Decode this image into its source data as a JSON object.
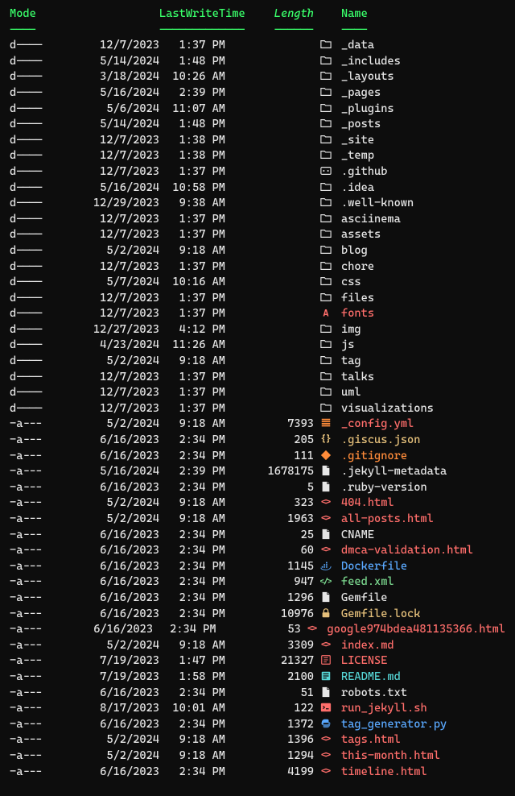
{
  "headers": {
    "mode": "Mode",
    "lastwrite": "LastWriteTime",
    "length": "Length",
    "name": "Name"
  },
  "separators": {
    "mode": "----",
    "lastwrite": "-------------",
    "length": "------",
    "name": "----"
  },
  "rows": [
    {
      "mode": "d----",
      "date": "12/7/2023",
      "time": "1:37 PM",
      "length": "",
      "icon": "folder",
      "name": "_data",
      "iconColor": "c-white",
      "nameColor": "c-white"
    },
    {
      "mode": "d----",
      "date": "5/14/2024",
      "time": "1:48 PM",
      "length": "",
      "icon": "folder",
      "name": "_includes",
      "iconColor": "c-white",
      "nameColor": "c-white"
    },
    {
      "mode": "d----",
      "date": "3/18/2024",
      "time": "10:26 AM",
      "length": "",
      "icon": "folder",
      "name": "_layouts",
      "iconColor": "c-white",
      "nameColor": "c-white"
    },
    {
      "mode": "d----",
      "date": "5/16/2024",
      "time": "2:39 PM",
      "length": "",
      "icon": "folder",
      "name": "_pages",
      "iconColor": "c-white",
      "nameColor": "c-white"
    },
    {
      "mode": "d----",
      "date": "5/6/2024",
      "time": "11:07 AM",
      "length": "",
      "icon": "folder",
      "name": "_plugins",
      "iconColor": "c-white",
      "nameColor": "c-white"
    },
    {
      "mode": "d----",
      "date": "5/14/2024",
      "time": "1:48 PM",
      "length": "",
      "icon": "folder",
      "name": "_posts",
      "iconColor": "c-white",
      "nameColor": "c-white"
    },
    {
      "mode": "d----",
      "date": "12/7/2023",
      "time": "1:38 PM",
      "length": "",
      "icon": "folder",
      "name": "_site",
      "iconColor": "c-white",
      "nameColor": "c-white"
    },
    {
      "mode": "d----",
      "date": "12/7/2023",
      "time": "1:38 PM",
      "length": "",
      "icon": "folder",
      "name": "_temp",
      "iconColor": "c-white",
      "nameColor": "c-white"
    },
    {
      "mode": "d----",
      "date": "12/7/2023",
      "time": "1:37 PM",
      "length": "",
      "icon": "github",
      "name": ".github",
      "iconColor": "c-white",
      "nameColor": "c-white"
    },
    {
      "mode": "d----",
      "date": "5/16/2024",
      "time": "10:58 PM",
      "length": "",
      "icon": "folder",
      "name": ".idea",
      "iconColor": "c-white",
      "nameColor": "c-white"
    },
    {
      "mode": "d----",
      "date": "12/29/2023",
      "time": "9:38 AM",
      "length": "",
      "icon": "folder",
      "name": ".well-known",
      "iconColor": "c-white",
      "nameColor": "c-white"
    },
    {
      "mode": "d----",
      "date": "12/7/2023",
      "time": "1:37 PM",
      "length": "",
      "icon": "folder",
      "name": "asciinema",
      "iconColor": "c-white",
      "nameColor": "c-white"
    },
    {
      "mode": "d----",
      "date": "12/7/2023",
      "time": "1:37 PM",
      "length": "",
      "icon": "folder",
      "name": "assets",
      "iconColor": "c-white",
      "nameColor": "c-white"
    },
    {
      "mode": "d----",
      "date": "5/2/2024",
      "time": "9:18 AM",
      "length": "",
      "icon": "folder",
      "name": "blog",
      "iconColor": "c-white",
      "nameColor": "c-white"
    },
    {
      "mode": "d----",
      "date": "12/7/2023",
      "time": "1:37 PM",
      "length": "",
      "icon": "folder",
      "name": "chore",
      "iconColor": "c-white",
      "nameColor": "c-white"
    },
    {
      "mode": "d----",
      "date": "5/7/2024",
      "time": "10:16 AM",
      "length": "",
      "icon": "folder",
      "name": "css",
      "iconColor": "c-white",
      "nameColor": "c-white"
    },
    {
      "mode": "d----",
      "date": "12/7/2023",
      "time": "1:37 PM",
      "length": "",
      "icon": "folder",
      "name": "files",
      "iconColor": "c-white",
      "nameColor": "c-white"
    },
    {
      "mode": "d----",
      "date": "12/7/2023",
      "time": "1:37 PM",
      "length": "",
      "icon": "fontA",
      "name": "fonts",
      "iconColor": "c-red",
      "nameColor": "c-red"
    },
    {
      "mode": "d----",
      "date": "12/27/2023",
      "time": "4:12 PM",
      "length": "",
      "icon": "folder",
      "name": "img",
      "iconColor": "c-white",
      "nameColor": "c-white"
    },
    {
      "mode": "d----",
      "date": "4/23/2024",
      "time": "11:26 AM",
      "length": "",
      "icon": "folder",
      "name": "js",
      "iconColor": "c-white",
      "nameColor": "c-white"
    },
    {
      "mode": "d----",
      "date": "5/2/2024",
      "time": "9:18 AM",
      "length": "",
      "icon": "folder",
      "name": "tag",
      "iconColor": "c-white",
      "nameColor": "c-white"
    },
    {
      "mode": "d----",
      "date": "12/7/2023",
      "time": "1:37 PM",
      "length": "",
      "icon": "folder",
      "name": "talks",
      "iconColor": "c-white",
      "nameColor": "c-white"
    },
    {
      "mode": "d----",
      "date": "12/7/2023",
      "time": "1:37 PM",
      "length": "",
      "icon": "folder",
      "name": "uml",
      "iconColor": "c-white",
      "nameColor": "c-white"
    },
    {
      "mode": "d----",
      "date": "12/7/2023",
      "time": "1:37 PM",
      "length": "",
      "icon": "folder",
      "name": "visualizations",
      "iconColor": "c-white",
      "nameColor": "c-white"
    },
    {
      "mode": "-a---",
      "date": "5/2/2024",
      "time": "9:18 AM",
      "length": "7393",
      "icon": "lines",
      "name": "_config.yml",
      "iconColor": "c-orange",
      "nameColor": "c-red"
    },
    {
      "mode": "-a---",
      "date": "6/16/2023",
      "time": "2:34 PM",
      "length": "205",
      "icon": "braces",
      "name": ".giscus.json",
      "iconColor": "c-yellow",
      "nameColor": "c-yellow"
    },
    {
      "mode": "-a---",
      "date": "6/16/2023",
      "time": "2:34 PM",
      "length": "111",
      "icon": "gitdiamond",
      "name": ".gitignore",
      "iconColor": "c-orange",
      "nameColor": "c-orange"
    },
    {
      "mode": "-a---",
      "date": "5/16/2024",
      "time": "2:39 PM",
      "length": "1678175",
      "icon": "file",
      "name": ".jekyll-metadata",
      "iconColor": "c-white",
      "nameColor": "c-white"
    },
    {
      "mode": "-a---",
      "date": "6/16/2023",
      "time": "2:34 PM",
      "length": "5",
      "icon": "file",
      "name": ".ruby-version",
      "iconColor": "c-white",
      "nameColor": "c-white"
    },
    {
      "mode": "-a---",
      "date": "5/2/2024",
      "time": "9:18 AM",
      "length": "323",
      "icon": "code",
      "name": "404.html",
      "iconColor": "c-red",
      "nameColor": "c-red"
    },
    {
      "mode": "-a---",
      "date": "5/2/2024",
      "time": "9:18 AM",
      "length": "1963",
      "icon": "code",
      "name": "all-posts.html",
      "iconColor": "c-red",
      "nameColor": "c-red"
    },
    {
      "mode": "-a---",
      "date": "6/16/2023",
      "time": "2:34 PM",
      "length": "25",
      "icon": "file",
      "name": "CNAME",
      "iconColor": "c-white",
      "nameColor": "c-white"
    },
    {
      "mode": "-a---",
      "date": "6/16/2023",
      "time": "2:34 PM",
      "length": "60",
      "icon": "code",
      "name": "dmca-validation.html",
      "iconColor": "c-red",
      "nameColor": "c-red"
    },
    {
      "mode": "-a---",
      "date": "6/16/2023",
      "time": "2:34 PM",
      "length": "1145",
      "icon": "docker",
      "name": "Dockerfile",
      "iconColor": "c-blue",
      "nameColor": "c-blue"
    },
    {
      "mode": "-a---",
      "date": "6/16/2023",
      "time": "2:34 PM",
      "length": "947",
      "icon": "codeslash",
      "name": "feed.xml",
      "iconColor": "c-green",
      "nameColor": "c-green"
    },
    {
      "mode": "-a---",
      "date": "6/16/2023",
      "time": "2:34 PM",
      "length": "1296",
      "icon": "file",
      "name": "Gemfile",
      "iconColor": "c-white",
      "nameColor": "c-white"
    },
    {
      "mode": "-a---",
      "date": "6/16/2023",
      "time": "2:34 PM",
      "length": "10976",
      "icon": "lock",
      "name": "Gemfile.lock",
      "iconColor": "c-yellow",
      "nameColor": "c-yellow"
    },
    {
      "mode": "-a---",
      "date": "6/16/2023",
      "time": "2:34 PM",
      "length": "53",
      "icon": "code",
      "name": "google974bdea481135366.html",
      "iconColor": "c-red",
      "nameColor": "c-red"
    },
    {
      "mode": "-a---",
      "date": "5/2/2024",
      "time": "9:18 AM",
      "length": "3309",
      "icon": "code",
      "name": "index.md",
      "iconColor": "c-red",
      "nameColor": "c-red"
    },
    {
      "mode": "-a---",
      "date": "7/19/2023",
      "time": "1:47 PM",
      "length": "21327",
      "icon": "license",
      "name": "LICENSE",
      "iconColor": "c-red",
      "nameColor": "c-red"
    },
    {
      "mode": "-a---",
      "date": "7/19/2023",
      "time": "1:58 PM",
      "length": "2100",
      "icon": "readme",
      "name": "README.md",
      "iconColor": "c-cyan",
      "nameColor": "c-cyan"
    },
    {
      "mode": "-a---",
      "date": "6/16/2023",
      "time": "2:34 PM",
      "length": "51",
      "icon": "file",
      "name": "robots.txt",
      "iconColor": "c-white",
      "nameColor": "c-white"
    },
    {
      "mode": "-a---",
      "date": "8/17/2023",
      "time": "10:01 AM",
      "length": "122",
      "icon": "terminal",
      "name": "run_jekyll.sh",
      "iconColor": "c-red",
      "nameColor": "c-red"
    },
    {
      "mode": "-a---",
      "date": "6/16/2023",
      "time": "2:34 PM",
      "length": "1372",
      "icon": "python",
      "name": "tag_generator.py",
      "iconColor": "c-blue",
      "nameColor": "c-blue"
    },
    {
      "mode": "-a---",
      "date": "5/2/2024",
      "time": "9:18 AM",
      "length": "1396",
      "icon": "code",
      "name": "tags.html",
      "iconColor": "c-red",
      "nameColor": "c-red"
    },
    {
      "mode": "-a---",
      "date": "5/2/2024",
      "time": "9:18 AM",
      "length": "1294",
      "icon": "code",
      "name": "this-month.html",
      "iconColor": "c-red",
      "nameColor": "c-red"
    },
    {
      "mode": "-a---",
      "date": "6/16/2023",
      "time": "2:34 PM",
      "length": "4199",
      "icon": "code",
      "name": "timeline.html",
      "iconColor": "c-red",
      "nameColor": "c-red"
    }
  ]
}
